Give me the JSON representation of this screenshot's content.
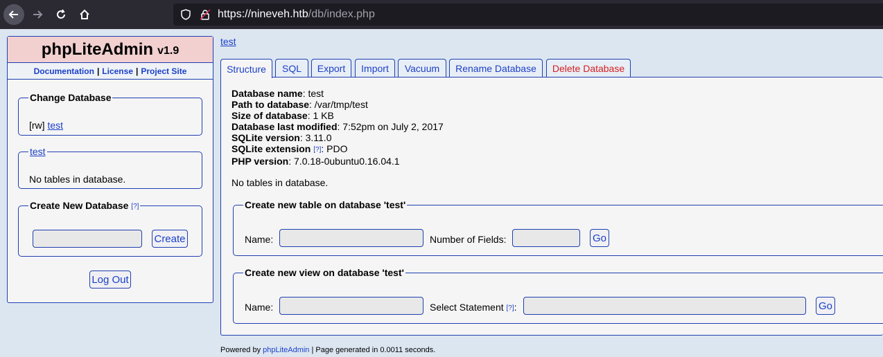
{
  "browser": {
    "url_host": "https://nineveh.htb",
    "url_path": "/db/index.php"
  },
  "sidebar": {
    "app_name": "phpLiteAdmin",
    "version": "v1.9",
    "links": [
      "Documentation",
      "License",
      "Project Site"
    ],
    "change_db": {
      "legend": "Change Database",
      "mode": "[rw]",
      "db_name": "test"
    },
    "current_db": {
      "legend": "test",
      "message": "No tables in database."
    },
    "create_db": {
      "legend": "Create New Database",
      "help": "[?]",
      "input_value": "",
      "button": "Create"
    },
    "logout": "Log Out"
  },
  "main": {
    "db_link": "test",
    "tabs": [
      "Structure",
      "SQL",
      "Export",
      "Import",
      "Vacuum",
      "Rename Database",
      "Delete Database"
    ],
    "info": {
      "db_name_label": "Database name",
      "db_name_value": ": test",
      "path_label": "Path to database",
      "path_value": ": /var/tmp/test",
      "size_label": "Size of database",
      "size_value": ": 1 KB",
      "modified_label": "Database last modified",
      "modified_value": ": 7:52pm on July 2, 2017",
      "sqlite_version_label": "SQLite version",
      "sqlite_version_value": ": 3.11.0",
      "sqlite_ext_label": "SQLite extension",
      "sqlite_ext_help": "[?]",
      "sqlite_ext_value": ": PDO",
      "php_version_label": "PHP version",
      "php_version_value": ": 7.0.18-0ubuntu0.16.04.1"
    },
    "no_tables": "No tables in database.",
    "create_table": {
      "legend": "Create new table on database 'test'",
      "name_label": "Name:",
      "fields_label": "Number of Fields:",
      "button": "Go"
    },
    "create_view": {
      "legend": "Create new view on database 'test'",
      "name_label": "Name:",
      "select_label": "Select Statement",
      "help": "[?]",
      "colon": ":",
      "button": "Go"
    }
  },
  "footer": {
    "prefix": "Powered by ",
    "link": "phpLiteAdmin",
    "suffix": " | Page generated in 0.0011 seconds."
  },
  "colors": {
    "link": "#1a3fc7",
    "danger": "#d42020",
    "border": "#1f3fb0",
    "logo_bg": "#f2d0d0"
  }
}
